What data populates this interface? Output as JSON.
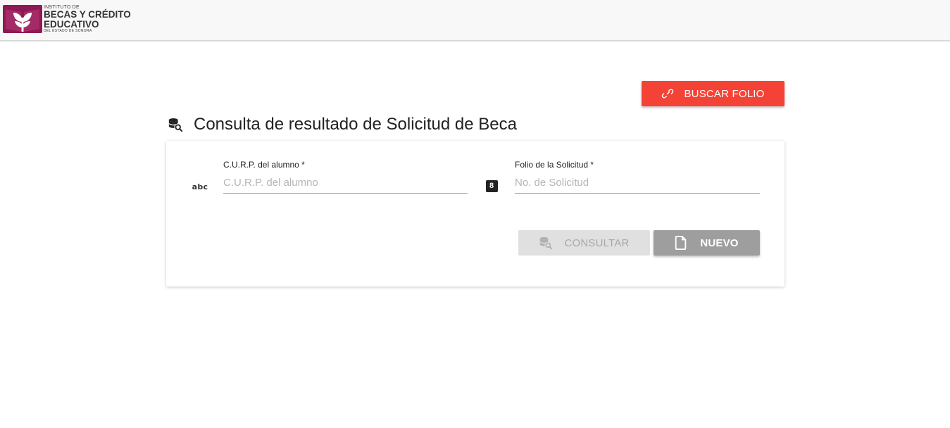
{
  "header": {
    "logo": {
      "line1": "INSTITUTO DE",
      "line2": "BECAS Y CRÉDITO",
      "line3": "EDUCATIVO",
      "line4": "DEL ESTADO DE SONORA",
      "brand_color": "#8e1a55"
    }
  },
  "actions": {
    "buscar_folio_label": "BUSCAR FOLIO",
    "buscar_folio_icon": "link-icon",
    "buscar_folio_color": "#f44336"
  },
  "page": {
    "title": "Consulta de resultado de Solicitud de Beca",
    "title_icon": "database-search-icon"
  },
  "form": {
    "curp": {
      "label": "C.U.R.P. del alumno *",
      "placeholder": "C.U.R.P. del alumno",
      "value": "",
      "prefix_icon": "abc",
      "prefix_icon_name": "alphabetical-icon"
    },
    "folio": {
      "label": "Folio de la Solicitud *",
      "placeholder": "No. de Solicitud",
      "value": "",
      "prefix_icon": "8",
      "prefix_icon_name": "numeric-icon"
    },
    "consultar_label": "CONSULTAR",
    "consultar_icon": "database-search-icon",
    "nuevo_label": "NUEVO",
    "nuevo_icon": "file-icon"
  }
}
